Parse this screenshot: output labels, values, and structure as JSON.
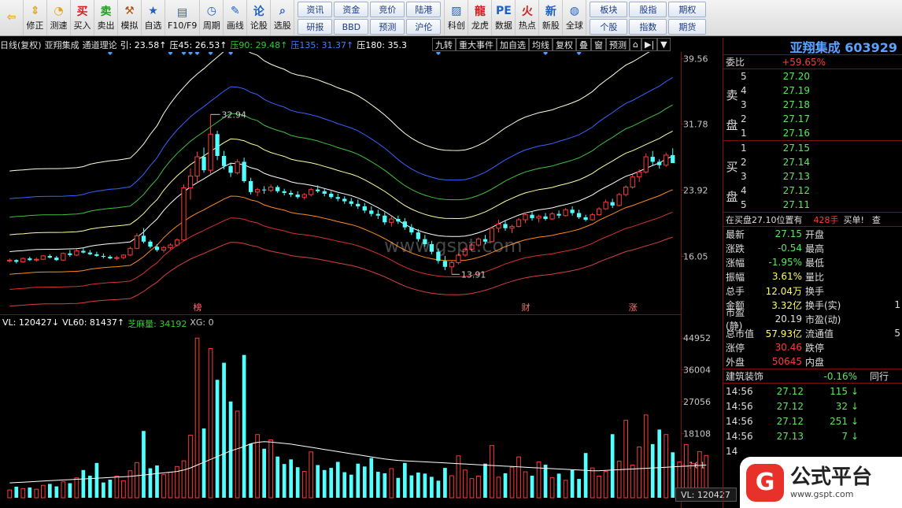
{
  "toolbar": {
    "buttons": [
      {
        "label": "",
        "icon": "back-arrow-icon",
        "glyph": "⇦"
      },
      {
        "label": "修正",
        "icon": "up-down-icon",
        "glyph": "⇕"
      },
      {
        "label": "测速",
        "icon": "speed-icon",
        "glyph": "◔"
      },
      {
        "label": "买入",
        "icon": "buy-icon",
        "glyph": "买"
      },
      {
        "label": "卖出",
        "icon": "sell-icon",
        "glyph": "卖"
      },
      {
        "label": "模拟",
        "icon": "hammer-icon",
        "glyph": "⚒"
      },
      {
        "label": "自选",
        "icon": "star-icon",
        "glyph": "★"
      },
      {
        "label": "F10/F9",
        "icon": "f10-icon",
        "glyph": "▤"
      },
      {
        "label": "周期",
        "icon": "clock-icon",
        "glyph": "◷"
      },
      {
        "label": "画线",
        "icon": "pencil-icon",
        "glyph": "✎"
      },
      {
        "label": "论股",
        "icon": "discuss-icon",
        "glyph": "论"
      },
      {
        "label": "选股",
        "icon": "magnifier-icon",
        "glyph": "⌕"
      }
    ],
    "grid1": [
      "资讯",
      "资金",
      "竞价",
      "陆港",
      "研报",
      "BBD",
      "预测",
      "沪伦"
    ],
    "buttons2": [
      {
        "label": "科创",
        "icon": "chart-icon",
        "glyph": "▨"
      },
      {
        "label": "龙虎",
        "icon": "dragon-icon",
        "glyph": "龍"
      },
      {
        "label": "数据",
        "icon": "pe-icon",
        "glyph": "PE"
      },
      {
        "label": "热点",
        "icon": "fire-icon",
        "glyph": "火"
      },
      {
        "label": "新股",
        "icon": "ipo-icon",
        "glyph": "新"
      },
      {
        "label": "全球",
        "icon": "globe-icon",
        "glyph": "◍"
      }
    ],
    "grid2": [
      "板块",
      "股指",
      "期权",
      "个股",
      "指数",
      "期货"
    ]
  },
  "chart_header": {
    "period": "日线(复权)",
    "stock": "亚翔集成",
    "indicator": "通道理论",
    "items": [
      {
        "text": "引: 23.58↑",
        "color": "#ffffff"
      },
      {
        "text": "压45: 26.53↑",
        "color": "#ffffff"
      },
      {
        "text": "压90: 29.48↑",
        "color": "#33cc33"
      },
      {
        "text": "压135: 31.37↑",
        "color": "#4a7dff"
      },
      {
        "text": "压180: 35.3",
        "color": "#ffffff"
      }
    ]
  },
  "chart_tools": [
    "九转",
    "重大事件",
    "加自选",
    "均线",
    "复权",
    "叠",
    "窗",
    "预测",
    "⌂",
    "▶|",
    "▼"
  ],
  "price_axis": [
    "39.56",
    "31.78",
    "23.92",
    "16.05"
  ],
  "volume_header": [
    {
      "text": "VL: 120427↓",
      "color": "#ffffff"
    },
    {
      "text": "VL60: 81437↑",
      "color": "#ffffff"
    },
    {
      "text": "芝麻量: 34192",
      "color": "#33cc33"
    },
    {
      "text": "XG: 0",
      "color": "#c8c8c8"
    }
  ],
  "volume_axis": [
    "44952",
    "36004",
    "27056",
    "18108",
    "9161"
  ],
  "vl_readout": "VL: 120427",
  "annotations": {
    "high": "32.94",
    "low": "13.91",
    "events": [
      "榜",
      "财",
      "涨"
    ]
  },
  "watermark": "www.gspt.com",
  "chart_data": {
    "type": "candlestick",
    "title": "",
    "ylim": [
      10,
      40
    ],
    "price_ticks": [
      39.56,
      31.78,
      23.92,
      16.05
    ],
    "annotated_high": 32.94,
    "annotated_low": 13.91,
    "candles": [
      [
        15.5,
        15.8,
        15.3,
        15.6
      ],
      [
        15.6,
        15.7,
        15.2,
        15.4
      ],
      [
        15.4,
        15.9,
        15.3,
        15.8
      ],
      [
        15.8,
        16.0,
        15.5,
        15.6
      ],
      [
        15.6,
        15.9,
        15.4,
        15.7
      ],
      [
        15.7,
        16.2,
        15.6,
        16.1
      ],
      [
        16.1,
        16.3,
        15.8,
        15.9
      ],
      [
        15.9,
        16.1,
        15.5,
        15.6
      ],
      [
        15.6,
        16.5,
        15.5,
        16.4
      ],
      [
        16.4,
        16.8,
        16.0,
        16.2
      ],
      [
        16.2,
        16.9,
        16.1,
        16.7
      ],
      [
        16.7,
        17.1,
        16.4,
        16.5
      ],
      [
        16.5,
        16.8,
        16.2,
        16.3
      ],
      [
        16.3,
        16.6,
        16.0,
        16.1
      ],
      [
        16.1,
        16.4,
        15.8,
        16.0
      ],
      [
        16.0,
        16.2,
        15.7,
        15.8
      ],
      [
        15.8,
        16.1,
        15.6,
        15.9
      ],
      [
        15.9,
        16.3,
        15.7,
        16.2
      ],
      [
        16.2,
        17.2,
        16.1,
        17.0
      ],
      [
        17.0,
        18.8,
        16.9,
        18.5
      ],
      [
        18.5,
        19.4,
        17.6,
        17.8
      ],
      [
        17.8,
        18.0,
        17.0,
        17.2
      ],
      [
        17.2,
        17.5,
        16.6,
        16.8
      ],
      [
        16.8,
        17.3,
        16.5,
        17.1
      ],
      [
        17.1,
        17.6,
        16.9,
        17.4
      ],
      [
        17.4,
        18.2,
        17.2,
        18.0
      ],
      [
        18.0,
        24.6,
        17.9,
        24.2
      ],
      [
        24.2,
        26.5,
        22.8,
        25.6
      ],
      [
        25.6,
        28.5,
        24.8,
        27.9
      ],
      [
        27.9,
        29.0,
        26.0,
        26.3
      ],
      [
        26.3,
        32.94,
        25.9,
        30.6
      ],
      [
        30.6,
        31.0,
        27.5,
        28.0
      ],
      [
        28.0,
        28.6,
        26.4,
        26.8
      ],
      [
        26.8,
        27.2,
        25.5,
        26.0
      ],
      [
        26.0,
        27.6,
        25.8,
        27.3
      ],
      [
        27.3,
        27.8,
        24.8,
        25.0
      ],
      [
        25.0,
        25.4,
        23.4,
        23.7
      ],
      [
        23.7,
        24.2,
        23.2,
        24.0
      ],
      [
        24.0,
        24.4,
        23.5,
        23.9
      ],
      [
        23.9,
        24.6,
        23.7,
        24.3
      ],
      [
        24.3,
        24.5,
        23.6,
        23.8
      ],
      [
        23.8,
        24.1,
        23.3,
        23.6
      ],
      [
        23.6,
        23.9,
        23.1,
        23.4
      ],
      [
        23.4,
        23.8,
        22.9,
        23.1
      ],
      [
        23.1,
        23.6,
        22.8,
        23.4
      ],
      [
        23.4,
        24.2,
        23.2,
        24.0
      ],
      [
        24.0,
        24.5,
        23.6,
        23.8
      ],
      [
        23.8,
        24.1,
        23.2,
        23.5
      ],
      [
        23.5,
        23.8,
        22.9,
        23.1
      ],
      [
        23.1,
        23.5,
        22.6,
        22.9
      ],
      [
        22.9,
        23.2,
        22.3,
        22.6
      ],
      [
        22.6,
        23.0,
        22.0,
        22.3
      ],
      [
        22.3,
        22.8,
        21.7,
        22.0
      ],
      [
        22.0,
        22.4,
        21.2,
        21.5
      ],
      [
        21.5,
        22.0,
        20.8,
        21.1
      ],
      [
        21.1,
        21.6,
        20.5,
        20.9
      ],
      [
        20.9,
        21.3,
        19.8,
        20.1
      ],
      [
        20.1,
        20.8,
        19.6,
        20.5
      ],
      [
        20.5,
        20.9,
        19.9,
        20.2
      ],
      [
        20.2,
        20.6,
        19.2,
        19.5
      ],
      [
        19.5,
        19.9,
        18.6,
        18.9
      ],
      [
        18.9,
        19.3,
        17.8,
        18.1
      ],
      [
        18.1,
        18.6,
        17.2,
        17.5
      ],
      [
        17.5,
        17.9,
        16.3,
        16.6
      ],
      [
        16.6,
        17.0,
        15.2,
        15.5
      ],
      [
        15.5,
        16.1,
        14.4,
        14.8
      ],
      [
        14.8,
        15.6,
        13.91,
        15.3
      ],
      [
        15.3,
        16.4,
        15.1,
        16.2
      ],
      [
        16.2,
        17.1,
        16.0,
        16.9
      ],
      [
        16.9,
        17.6,
        16.7,
        17.4
      ],
      [
        17.4,
        18.3,
        17.2,
        18.1
      ],
      [
        18.1,
        18.6,
        17.5,
        17.8
      ],
      [
        17.8,
        19.6,
        17.7,
        19.4
      ],
      [
        19.4,
        20.4,
        18.9,
        19.9
      ],
      [
        19.9,
        20.3,
        19.1,
        19.4
      ],
      [
        19.4,
        19.8,
        18.8,
        19.6
      ],
      [
        19.6,
        20.6,
        19.5,
        20.4
      ],
      [
        20.4,
        21.3,
        20.0,
        21.0
      ],
      [
        21.0,
        21.4,
        20.3,
        20.6
      ],
      [
        20.6,
        21.0,
        20.1,
        20.8
      ],
      [
        20.8,
        21.2,
        20.3,
        20.5
      ],
      [
        20.5,
        21.3,
        20.4,
        21.1
      ],
      [
        21.1,
        21.5,
        20.6,
        20.9
      ],
      [
        20.9,
        21.8,
        20.8,
        21.6
      ],
      [
        21.6,
        22.0,
        20.9,
        21.2
      ],
      [
        21.2,
        21.6,
        20.5,
        20.7
      ],
      [
        20.7,
        21.0,
        20.2,
        20.4
      ],
      [
        20.4,
        21.2,
        20.3,
        21.0
      ],
      [
        21.0,
        21.9,
        20.9,
        21.7
      ],
      [
        21.7,
        22.8,
        21.6,
        22.5
      ],
      [
        22.5,
        22.9,
        21.8,
        22.1
      ],
      [
        22.1,
        23.6,
        22.0,
        23.4
      ],
      [
        23.4,
        24.5,
        23.2,
        24.3
      ],
      [
        24.3,
        25.8,
        24.1,
        25.5
      ],
      [
        25.5,
        26.4,
        24.9,
        26.1
      ],
      [
        26.1,
        28.3,
        25.9,
        27.9
      ],
      [
        27.9,
        28.6,
        26.8,
        27.3
      ],
      [
        27.3,
        27.6,
        26.5,
        26.9
      ],
      [
        26.9,
        28.4,
        26.7,
        28.1
      ],
      [
        28.1,
        28.9,
        27.3,
        27.15
      ]
    ],
    "volume": [
      2200,
      3100,
      2600,
      2900,
      2400,
      3500,
      3900,
      3200,
      4500,
      4100,
      5600,
      7800,
      6200,
      9800,
      4300,
      5100,
      6100,
      4800,
      7600,
      9900,
      18800,
      8300,
      9100,
      6500,
      7200,
      8800,
      10400,
      17600,
      44952,
      19500,
      42000,
      33200,
      38000,
      27100,
      24400,
      40200,
      15200,
      17800,
      13800,
      16300,
      11600,
      9500,
      10800,
      8600,
      7400,
      12900,
      9200,
      7800,
      8400,
      10100,
      7200,
      6500,
      9600,
      8800,
      11200,
      7300,
      6900,
      8200,
      5600,
      9800,
      6300,
      7100,
      6800,
      5900,
      4800,
      8400,
      6200,
      11800,
      7800,
      5400,
      6100,
      9600,
      14700,
      5800,
      6900,
      8600,
      11500,
      7300,
      6200,
      10100,
      9300,
      5700,
      6800,
      4900,
      7800,
      5300,
      12600,
      8400,
      6100,
      7400,
      17900,
      10300,
      21800,
      9200,
      14300,
      23300,
      15100,
      19200,
      17800,
      12800,
      10100,
      15000,
      9600,
      13000,
      11900
    ],
    "vl60": [
      4200,
      4300,
      4400,
      4500,
      4600,
      4700,
      4800,
      4900,
      5000,
      5100,
      5200,
      5300,
      5400,
      5500,
      5600,
      5700,
      5800,
      5900,
      6000,
      6200,
      6400,
      6600,
      6800,
      7000,
      7200,
      7400,
      7800,
      8400,
      9200,
      10000,
      10800,
      11600,
      12400,
      13200,
      13800,
      14400,
      15200,
      15600,
      15800,
      15700,
      15500,
      15300,
      15100,
      14800,
      14500,
      14200,
      13900,
      13600,
      13300,
      13000,
      12700,
      12400,
      12100,
      11800,
      11500,
      11200,
      10900,
      10700,
      10500,
      10400,
      10300,
      10200,
      10100,
      10000,
      9900,
      9800,
      9700,
      9600,
      9500,
      9400,
      9300,
      9200,
      9100,
      9000,
      8900,
      8800,
      8700,
      8600,
      8500,
      8400,
      8300,
      8200,
      8100,
      8000,
      7900,
      7800,
      7700,
      7600,
      7600,
      7700,
      7800,
      7900,
      8000,
      8100,
      8200,
      8300,
      8400,
      8500,
      8600,
      8700,
      8800,
      8900,
      9000,
      9100,
      9200
    ],
    "channel_levels": [
      {
        "name": "压180",
        "color": "#ffffe0"
      },
      {
        "name": "压135",
        "color": "#3b62ff"
      },
      {
        "name": "压90",
        "color": "#3fc03f"
      },
      {
        "name": "压45",
        "color": "#ffffa0"
      },
      {
        "name": "引",
        "color": "#ffffff"
      },
      {
        "name": "撑",
        "color": "#ff8c1a"
      },
      {
        "name": "撑",
        "color": "#d83030"
      },
      {
        "name": "撑",
        "color": "#d84040"
      }
    ]
  },
  "right_panel": {
    "title": "亚翔集成 603929",
    "weibi_label": "委比",
    "weibi_value": "+59.65%",
    "sell_label": [
      "卖",
      "盘"
    ],
    "buy_label": [
      "买",
      "盘"
    ],
    "sell": [
      {
        "i": "5",
        "p": "27.20"
      },
      {
        "i": "4",
        "p": "27.19"
      },
      {
        "i": "3",
        "p": "27.18"
      },
      {
        "i": "2",
        "p": "27.17"
      },
      {
        "i": "1",
        "p": "27.16"
      }
    ],
    "buy": [
      {
        "i": "1",
        "p": "27.15"
      },
      {
        "i": "2",
        "p": "27.14"
      },
      {
        "i": "3",
        "p": "27.13"
      },
      {
        "i": "4",
        "p": "27.12"
      },
      {
        "i": "5",
        "p": "27.11"
      }
    ],
    "order_note": "在买盘27.10位置有",
    "order_qty": "428手",
    "order_type": "买单!",
    "order_more": "查",
    "quotes": [
      {
        "l": "最新",
        "v": "27.15",
        "vc": "#58e858",
        "r": "开盘",
        "v2": ""
      },
      {
        "l": "涨跌",
        "v": "-0.54",
        "vc": "#58e858",
        "r": "最高",
        "v2": ""
      },
      {
        "l": "涨幅",
        "v": "-1.95%",
        "vc": "#58e858",
        "r": "最低",
        "v2": ""
      },
      {
        "l": "振幅",
        "v": "3.61%",
        "vc": "#ffff54",
        "r": "量比",
        "v2": ""
      },
      {
        "l": "总手",
        "v": "12.04万",
        "vc": "#ffff54",
        "r": "换手",
        "v2": ""
      },
      {
        "l": "金额",
        "v": "3.32亿",
        "vc": "#ffff54",
        "r": "换手(实)",
        "v2": "1"
      },
      {
        "l": "市盈(静)",
        "v": "20.19",
        "vc": "#e0e0e0",
        "r": "市盈(动)",
        "v2": ""
      },
      {
        "l": "总市值",
        "v": "57.93亿",
        "vc": "#ffff54",
        "r": "流通值",
        "v2": "5"
      },
      {
        "l": "涨停",
        "v": "30.46",
        "vc": "#ff3a3a",
        "r": "跌停",
        "v2": ""
      },
      {
        "l": "外盘",
        "v": "50645",
        "vc": "#ff3a3a",
        "r": "内盘",
        "v2": ""
      }
    ],
    "sector_name": "建筑装饰",
    "sector_change": "-0.16%",
    "sector_more": "同行",
    "ticks": [
      {
        "t": "14:56",
        "p": "27.12",
        "v": "115",
        "a": "↓"
      },
      {
        "t": "14:56",
        "p": "27.12",
        "v": "32",
        "a": "↓"
      },
      {
        "t": "14:56",
        "p": "27.12",
        "v": "251",
        "a": "↓"
      },
      {
        "t": "14:56",
        "p": "27.13",
        "v": "7",
        "a": "↓"
      },
      {
        "t": "14",
        "p": "",
        "v": "",
        "a": ""
      }
    ]
  },
  "logo": {
    "mark": "G",
    "cn": "公式平台",
    "url": "www.gspt.com"
  }
}
